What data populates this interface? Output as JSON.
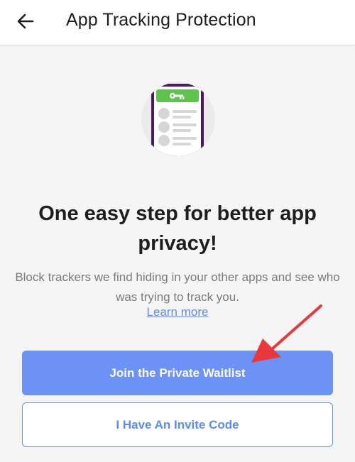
{
  "header": {
    "back_icon": "arrow-left-icon",
    "title": "App Tracking Protection"
  },
  "hero": {
    "icon": "phone-with-key-illustration",
    "colors": {
      "phone_frame": "#4b1b5e",
      "key_banner": "#5ec44e",
      "circle": "#ebebeb"
    }
  },
  "main": {
    "headline": "One easy step for better app privacy!",
    "description": "Block trackers we find hiding in your other apps and see who was trying to track you.",
    "learn_more": "Learn more"
  },
  "actions": {
    "primary_label": "Join the Private Waitlist",
    "secondary_label": "I Have An Invite Code"
  },
  "annotation": {
    "icon": "red-arrow-annotation",
    "color": "#e8383d"
  },
  "colors": {
    "accent": "#6b92f4",
    "link": "#5b8cf0",
    "background": "#f5f5f5"
  }
}
